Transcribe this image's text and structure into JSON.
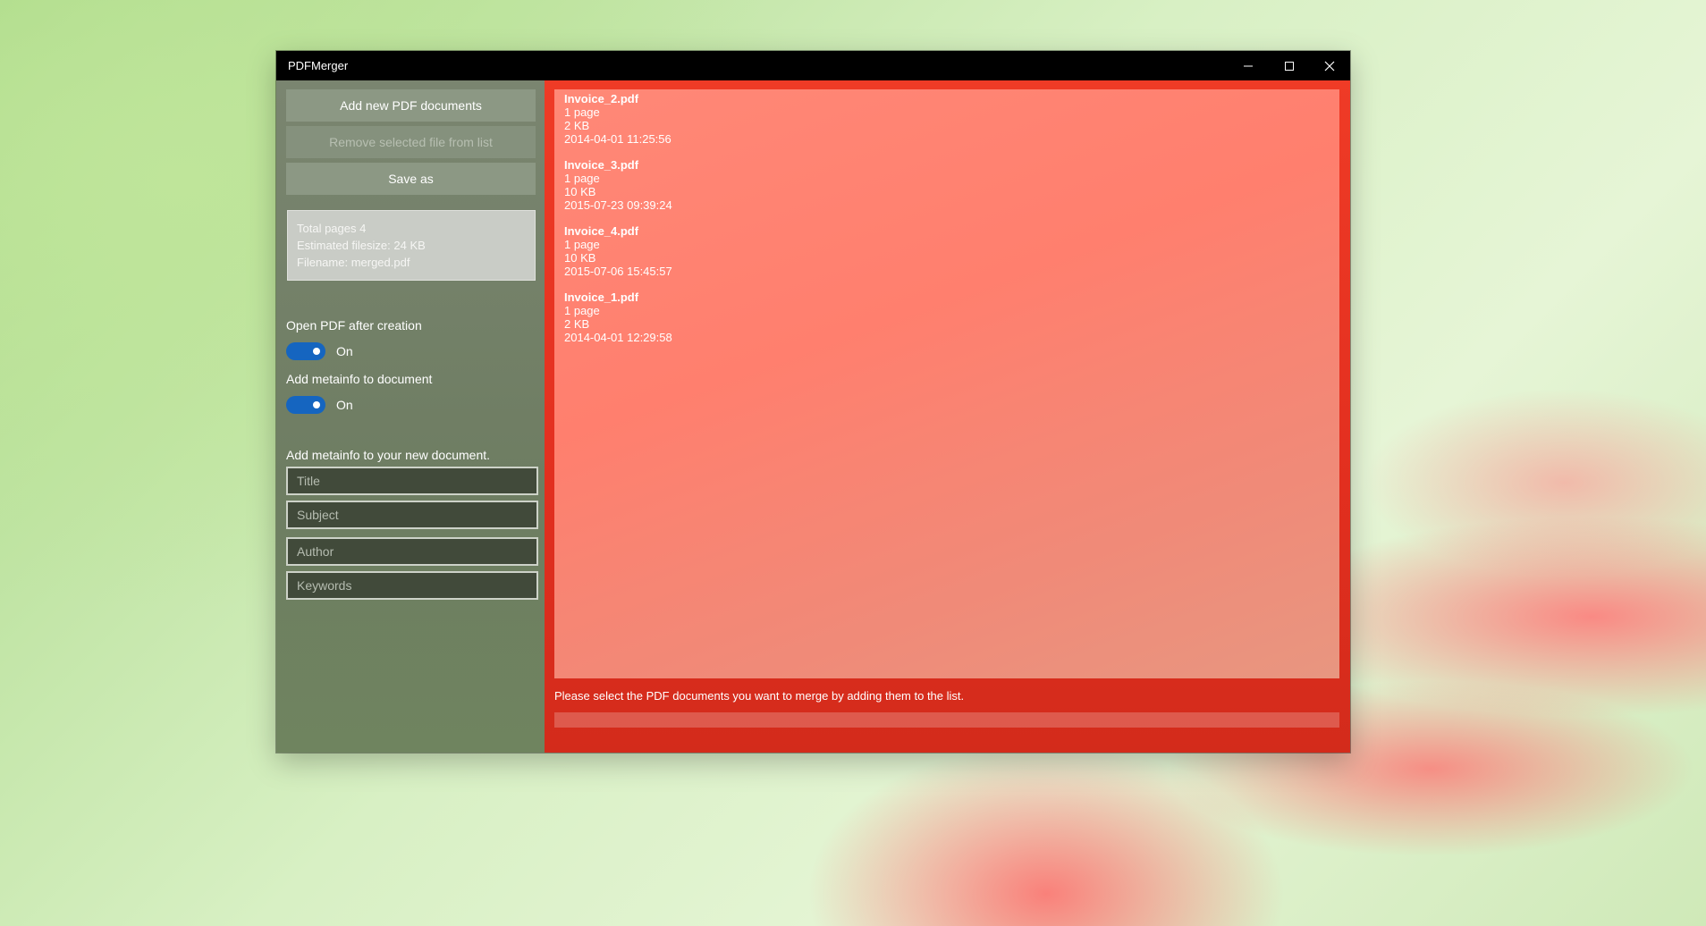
{
  "window": {
    "title": "PDFMerger",
    "controls": {
      "minimize_icon": "minimize-icon",
      "maximize_icon": "maximize-icon",
      "close_icon": "close-icon"
    }
  },
  "sidebar": {
    "add_button": "Add new PDF documents",
    "remove_button": "Remove selected file from list",
    "save_button": "Save as",
    "summary": {
      "total_pages": "Total pages 4",
      "filesize": "Estimated filesize: 24 KB",
      "filename": "Filename: merged.pdf"
    },
    "open_after_label": "Open PDF after creation",
    "open_after_state": "On",
    "add_metainfo_label": "Add metainfo to document",
    "add_metainfo_state": "On",
    "meta_heading": "Add metainfo to your new document.",
    "fields": {
      "title_placeholder": "Title",
      "subject_placeholder": "Subject",
      "author_placeholder": "Author",
      "keywords_placeholder": "Keywords"
    }
  },
  "files": [
    {
      "name": "Invoice_2.pdf",
      "pages": "1 page",
      "size": "2 KB",
      "date": "2014-04-01 11:25:56"
    },
    {
      "name": "Invoice_3.pdf",
      "pages": "1 page",
      "size": "10 KB",
      "date": "2015-07-23 09:39:24"
    },
    {
      "name": "Invoice_4.pdf",
      "pages": "1 page",
      "size": "10 KB",
      "date": "2015-07-06 15:45:57"
    },
    {
      "name": "Invoice_1.pdf",
      "pages": "1 page",
      "size": "2 KB",
      "date": "2014-04-01 12:29:58"
    }
  ],
  "status_text": "Please select the PDF documents you want to merge by adding them to the list.",
  "colors": {
    "accent": "#e22f1f",
    "toggle": "#1565c0",
    "titlebar": "#000000"
  }
}
